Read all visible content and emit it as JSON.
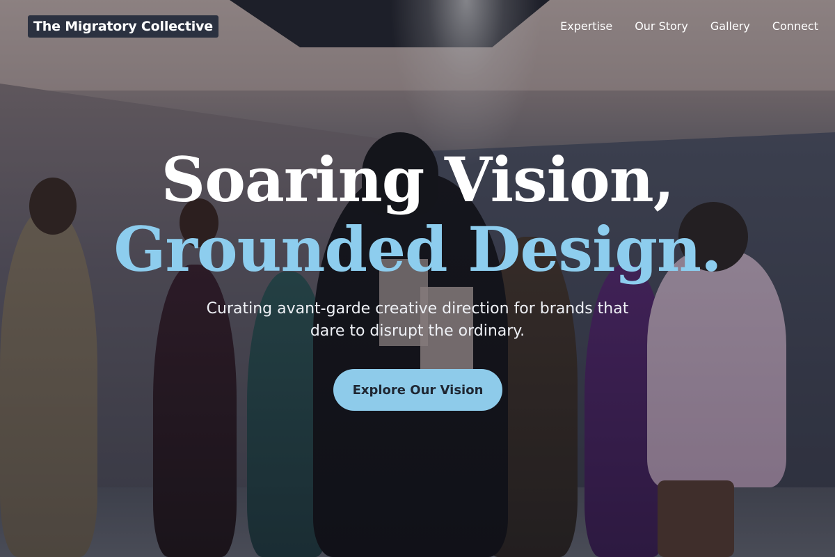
{
  "header": {
    "brand": "The Migratory Collective",
    "nav": [
      {
        "label": "Expertise"
      },
      {
        "label": "Our Story"
      },
      {
        "label": "Gallery"
      },
      {
        "label": "Connect"
      }
    ]
  },
  "hero": {
    "headline_line1": "Soaring Vision,",
    "headline_line2": "Grounded Design.",
    "subtitle": "Curating avant-garde creative direction for brands that dare to disrupt the ordinary.",
    "cta_label": "Explore Our Vision"
  },
  "colors": {
    "accent": "#8dcdee",
    "brand_badge_bg": "#2b3140",
    "cta_text": "#1f2733"
  }
}
